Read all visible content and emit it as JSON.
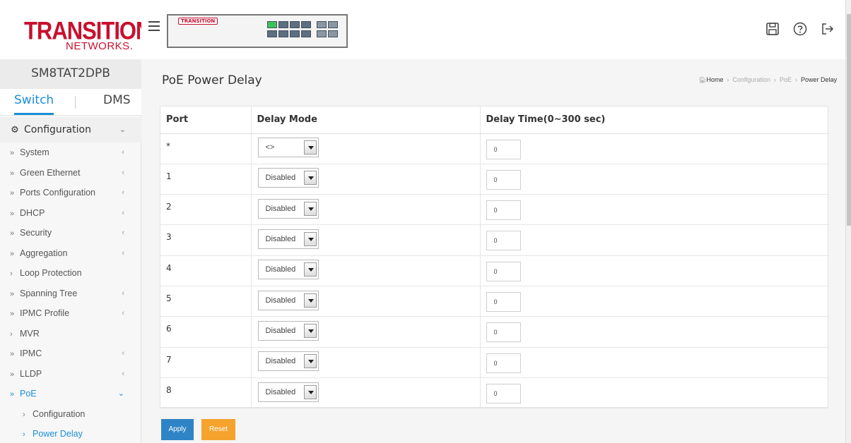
{
  "brand": {
    "logo_line1": "TRANSITION",
    "logo_line2": "NETWORKS.",
    "device_label": "TRANSITION"
  },
  "sidebar": {
    "model": "SM8TAT2DPB",
    "tabs": [
      "Switch",
      "DMS"
    ],
    "section_title": "Configuration",
    "section_chevron": "⌄",
    "items": [
      {
        "marker": "»",
        "label": "System",
        "arrow": "‹"
      },
      {
        "marker": "»",
        "label": "Green Ethernet",
        "arrow": "‹"
      },
      {
        "marker": "»",
        "label": "Ports Configuration",
        "arrow": "‹"
      },
      {
        "marker": "»",
        "label": "DHCP",
        "arrow": "‹"
      },
      {
        "marker": "»",
        "label": "Security",
        "arrow": "‹"
      },
      {
        "marker": "»",
        "label": "Aggregation",
        "arrow": "‹"
      },
      {
        "marker": "›",
        "label": "Loop Protection",
        "arrow": ""
      },
      {
        "marker": "»",
        "label": "Spanning Tree",
        "arrow": "‹"
      },
      {
        "marker": "»",
        "label": "IPMC Profile",
        "arrow": "‹"
      },
      {
        "marker": "›",
        "label": "MVR",
        "arrow": ""
      },
      {
        "marker": "»",
        "label": "IPMC",
        "arrow": "‹"
      },
      {
        "marker": "»",
        "label": "LLDP",
        "arrow": "‹"
      },
      {
        "marker": "»",
        "label": "PoE",
        "arrow": "⌄"
      }
    ],
    "sub_items": [
      {
        "marker": "›",
        "label": "Configuration"
      },
      {
        "marker": "›",
        "label": "Power Delay"
      }
    ]
  },
  "main": {
    "title": "PoE Power Delay",
    "breadcrumb": {
      "home": "Home",
      "items": [
        "Configuration",
        "PoE"
      ],
      "current": "Power Delay",
      "separator": "›"
    },
    "table": {
      "headers": [
        "Port",
        "Delay Mode",
        "Delay Time(0~300 sec)"
      ],
      "rows": [
        {
          "port": "*",
          "mode": "<>",
          "time": "0"
        },
        {
          "port": "1",
          "mode": "Disabled",
          "time": "0"
        },
        {
          "port": "2",
          "mode": "Disabled",
          "time": "0"
        },
        {
          "port": "3",
          "mode": "Disabled",
          "time": "0"
        },
        {
          "port": "4",
          "mode": "Disabled",
          "time": "0"
        },
        {
          "port": "5",
          "mode": "Disabled",
          "time": "0"
        },
        {
          "port": "6",
          "mode": "Disabled",
          "time": "0"
        },
        {
          "port": "7",
          "mode": "Disabled",
          "time": "0"
        },
        {
          "port": "8",
          "mode": "Disabled",
          "time": "0"
        }
      ]
    },
    "buttons": {
      "apply": "Apply",
      "reset": "Reset"
    }
  },
  "toolbar": {
    "icons": [
      "save-icon",
      "help-icon",
      "logout-icon"
    ]
  },
  "colors": {
    "brand_red": "#c8102e",
    "accent_blue": "#1a8fd6",
    "apply_blue": "#2f84c5",
    "reset_orange": "#f5a32d"
  }
}
